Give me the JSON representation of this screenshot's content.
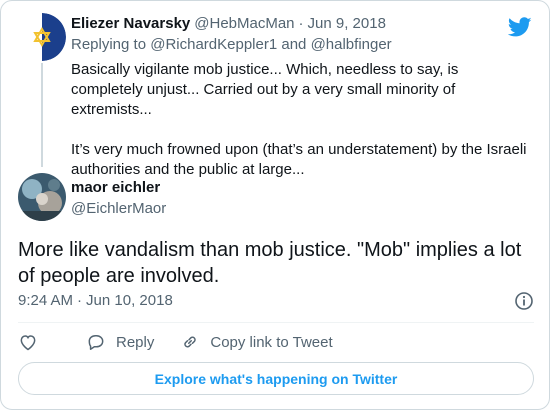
{
  "parent_tweet": {
    "name": "Eliezer Navarsky",
    "handle": "@HebMacMan",
    "separator": "·",
    "date": "Jun 9, 2018",
    "replying_prefix": "Replying to",
    "replying_user1": "@RichardKeppler1",
    "replying_and": "and",
    "replying_user2": "@halbfinger",
    "text": "Basically vigilante mob justice... Which, needless to say, is completely unjust... Carried out by a very small minority of extremists...\n\nIt’s very much frowned upon (that’s an understatement) by the Israeli authorities and the public at large..."
  },
  "main_tweet": {
    "name": "maor eichler",
    "handle": "@EichlerMaor",
    "text": "More like vandalism than mob justice. \"Mob\" implies a lot of people are involved.",
    "time": "9:24 AM",
    "separator": "·",
    "date": "Jun 10, 2018"
  },
  "actions": {
    "like_icon": "heart-icon",
    "reply_label": "Reply",
    "copy_label": "Copy link to Tweet"
  },
  "explore_label": "Explore what's happening on Twitter",
  "colors": {
    "brand_blue": "#1d9bf0",
    "text_primary": "#0f1419",
    "text_secondary": "#536471",
    "border": "#cfd9de"
  }
}
